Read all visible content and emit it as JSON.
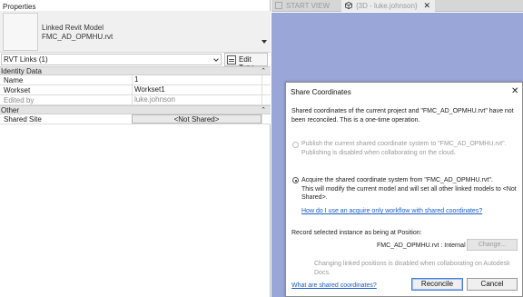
{
  "properties": {
    "title": "Properties",
    "type_line1": "Linked Revit Model",
    "type_line2": "FMC_AD_OPMHU.rvt",
    "selector_value": "RVT Links (1)",
    "edit_type_label": "Edit Type",
    "sections": [
      {
        "name": "Identity Data",
        "rows": [
          {
            "key": "Name",
            "value": "1"
          },
          {
            "key": "Workset",
            "value": "Workset1"
          },
          {
            "key": "Edited by",
            "value": "luke.johnson"
          }
        ]
      },
      {
        "name": "Other",
        "rows": [
          {
            "key": "Shared Site",
            "value": "<Not Shared>"
          }
        ]
      }
    ]
  },
  "tabs": {
    "start_view": "START VIEW",
    "view_3d": "{3D - luke.johnson}"
  },
  "dialog": {
    "title": "Share Coordinates",
    "intro_line1": "Shared coordinates of the current project and \"FMC_AD_OPMHU.rvt\" have not",
    "intro_line2": "been reconciled. This is a one-time operation.",
    "publish_line1": "Publish the current shared coordinate system to \"FMC_AD_OPMHU.rvt\".",
    "publish_line2": "Publishing is disabled when collaborating on the cloud.",
    "acquire_line1": "Acquire the shared coordinate system from \"FMC_AD_OPMHU.rvt\".",
    "acquire_line2": "This will modify the current model and will set all other linked models to <Not",
    "acquire_line3": "Shared>.",
    "help_link": "How do I use an acquire only workflow with shared coordinates?",
    "record_label": "Record selected instance as being at Position:",
    "position_value": "FMC_AD_OPMHU.rvt : Internal",
    "change_button": "Change...",
    "disabled_note": "Changing linked positions is disabled when collaborating on Autodesk Docs.",
    "what_link": "What are shared coordinates?",
    "reconcile_button": "Reconcile",
    "cancel_button": "Cancel"
  }
}
